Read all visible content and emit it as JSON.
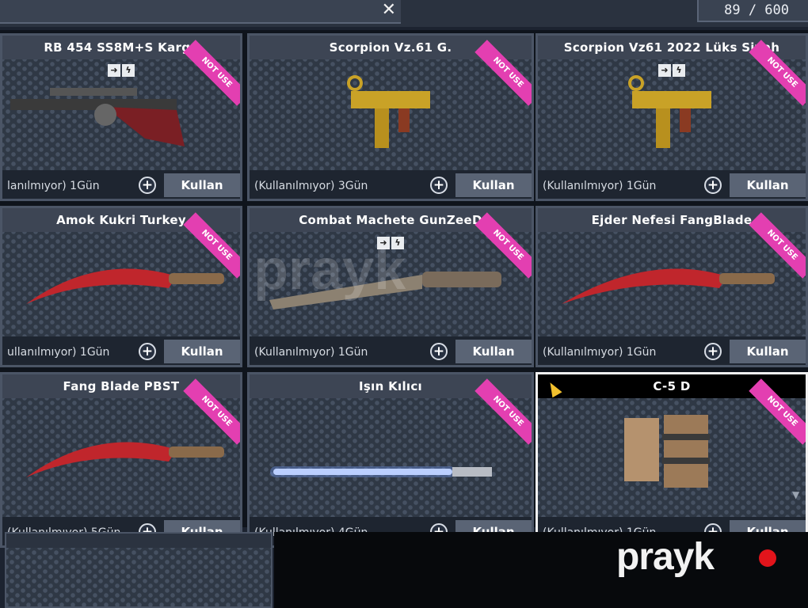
{
  "header": {
    "close_icon": "close-icon",
    "counter": "89 / 600"
  },
  "colors": {
    "badge": "#e33fb1",
    "selected_border": "#f2f2f2",
    "watermark_dot": "#e2141b",
    "cursor": "#f2c12e"
  },
  "badge_text": "NOT USE",
  "action_label": "Kullan",
  "items": [
    {
      "title": "RB 454 SS8M+S Karga",
      "status": "lanılmıyor) 1Gün",
      "badge": true,
      "mini_icons": true,
      "weapon": "sniper-rifle-icon"
    },
    {
      "title": "Scorpion Vz.61 G.",
      "status": "(Kullanılmıyor) 3Gün",
      "badge": true,
      "mini_icons": false,
      "weapon": "smg-icon"
    },
    {
      "title": "Scorpion Vz61 2022 Lüks Siyah",
      "status": "(Kullanılmıyor) 1Gün",
      "badge": true,
      "mini_icons": true,
      "weapon": "smg-icon"
    },
    {
      "title": "Amok Kukri Turkey",
      "status": "ullanılmıyor) 1Gün",
      "badge": true,
      "mini_icons": false,
      "weapon": "knife-icon"
    },
    {
      "title": "Combat Machete GunZeeD",
      "status": "(Kullanılmıyor) 1Gün",
      "badge": true,
      "mini_icons": true,
      "weapon": "machete-icon"
    },
    {
      "title": "Ejder Nefesi FangBlade",
      "status": "(Kullanılmıyor) 1Gün",
      "badge": true,
      "mini_icons": false,
      "weapon": "knife-icon"
    },
    {
      "title": "Fang Blade PBST",
      "status": "(Kullanılmıyor) 5Gün",
      "badge": true,
      "mini_icons": false,
      "weapon": "knife-icon"
    },
    {
      "title": "Işın Kılıcı",
      "status": "(Kullanılmıyor) 4Gün",
      "badge": true,
      "mini_icons": false,
      "weapon": "lightsaber-icon"
    },
    {
      "title": "C-5 D",
      "status": "(Kullanılmıyor) 1Gün",
      "badge": true,
      "mini_icons": false,
      "weapon": "explosive-icon",
      "selected": true
    }
  ],
  "watermark": {
    "text": "prayk"
  }
}
